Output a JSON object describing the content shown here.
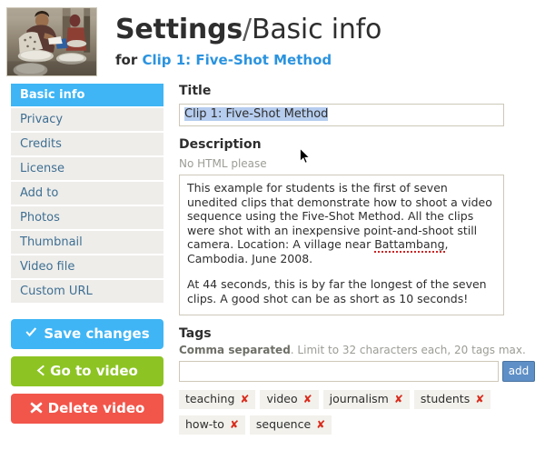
{
  "header": {
    "thumbnail_alt": "video-thumbnail",
    "title_strong": "Settings",
    "title_separator": "/",
    "title_section": "Basic info",
    "subtitle_prefix": "for",
    "subtitle_link": "Clip 1: Five-Shot Method"
  },
  "sidebar": {
    "items": [
      {
        "label": "Basic info",
        "active": true
      },
      {
        "label": "Privacy",
        "active": false
      },
      {
        "label": "Credits",
        "active": false
      },
      {
        "label": "License",
        "active": false
      },
      {
        "label": "Add to",
        "active": false
      },
      {
        "label": "Photos",
        "active": false
      },
      {
        "label": "Thumbnail",
        "active": false
      },
      {
        "label": "Video file",
        "active": false
      },
      {
        "label": "Custom URL",
        "active": false
      }
    ],
    "buttons": {
      "save_label": "Save changes",
      "save_icon": "check-icon",
      "save_color": "#3fb5f5",
      "goto_label": "Go to video",
      "goto_icon": "chevron-left-icon",
      "goto_color": "#8dc424",
      "delete_label": "Delete video",
      "delete_icon": "cross-icon",
      "delete_color": "#f2554a"
    }
  },
  "form": {
    "title": {
      "label": "Title",
      "value": "Clip 1: Five-Shot Method",
      "placeholder": "",
      "selected": true
    },
    "description": {
      "label": "Description",
      "hint": "No HTML please",
      "paragraph_1_before": "This example for students is the first of seven unedited clips that demonstrate how to shoot a video sequence using the Five-Shot Method. All the clips were shot with an inexpensive point-and-shoot still camera. Location: A village near ",
      "paragraph_1_misspelled": "Battambang",
      "paragraph_1_after": ", Cambodia. June 2008.",
      "paragraph_2": "At 44 seconds, this is by far the longest of the seven clips. A good shot can be as short as 10 seconds!"
    },
    "tags": {
      "label": "Tags",
      "hint_bold": "Comma separated",
      "hint_rest": ". Limit to 32 characters each, 20 tags max.",
      "input_value": "",
      "input_placeholder": "",
      "add_label": "add",
      "remove_glyph": "✘",
      "items": [
        "teaching",
        "video",
        "journalism",
        "students",
        "how-to",
        "sequence"
      ]
    }
  },
  "colors": {
    "accent_blue": "#3fb5f5",
    "link_blue": "#2b93df",
    "green": "#8dc424",
    "red": "#f2554a",
    "tag_remove_red": "#d92b1c",
    "sidebar_row": "#eeedea",
    "selection": "#b6cdef",
    "add_button": "#5e8fc6"
  }
}
